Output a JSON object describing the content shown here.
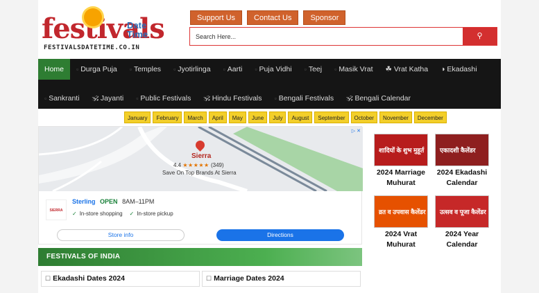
{
  "brand": {
    "logo_main": "festivals",
    "logo_date": "Date",
    "logo_time": "Time",
    "logo_sub": "FESTIVALSDATETIME.CO.IN"
  },
  "top_buttons": [
    "Support Us",
    "Contact Us",
    "Sponsor"
  ],
  "search": {
    "placeholder": "Search Here..."
  },
  "nav": {
    "row1": [
      "Home",
      "Durga Puja",
      "Temples",
      "Jyotirlinga",
      "Aarti",
      "Puja Vidhi",
      "Teej",
      "Masik Vrat",
      "☘ Vrat Katha",
      "◑ Ekadashi"
    ],
    "row2": [
      "Sankranti",
      "🕉 Jayanti",
      "Public Festivals",
      "🕉 Hindu Festivals",
      "Bengali Festivals",
      "🕉 Bengali Calendar"
    ]
  },
  "months": [
    "January",
    "February",
    "March",
    "April",
    "May",
    "June",
    "July",
    "August",
    "September",
    "October",
    "November",
    "December"
  ],
  "ad": {
    "place_name": "Sierra",
    "rating": "4.4",
    "stars": "★★★★★",
    "reviews": "(349)",
    "tagline": "Save On Top Brands At Sierra",
    "brand_logo": "SIERRA",
    "store": "Sterling",
    "open": "OPEN",
    "hours": "8AM–11PM",
    "features": [
      "In-store shopping",
      "In-store pickup"
    ],
    "store_info": "Store info",
    "directions": "Directions"
  },
  "festivals_heading": "FESTIVALS OF INDIA",
  "festival_links": [
    "Ekadashi Dates 2024",
    "Marriage Dates 2024"
  ],
  "cards": [
    {
      "label_line1": "2024 Marriage",
      "label_line2": "Muhurat",
      "img_text": "शादियों के शुभ मुहूर्त",
      "color": "#b71c1c"
    },
    {
      "label_line1": "2024 Ekadashi",
      "label_line2": "Calendar",
      "img_text": "एकादशी कैलेंडर",
      "color": "#8e1f1f"
    },
    {
      "label_line1": "2024 Vrat",
      "label_line2": "Muhurat",
      "img_text": "व्रत व उपवास कैलेंडर",
      "color": "#e65100"
    },
    {
      "label_line1": "2024 Year",
      "label_line2": "Calendar",
      "img_text": "उत्सव व पूजा कैलेंडर",
      "color": "#c62828"
    }
  ],
  "colors": {
    "accent": "#d0622c",
    "nav_active": "#2e7d32",
    "nav_bg": "#151515",
    "month_bg": "#f3cf2a"
  }
}
